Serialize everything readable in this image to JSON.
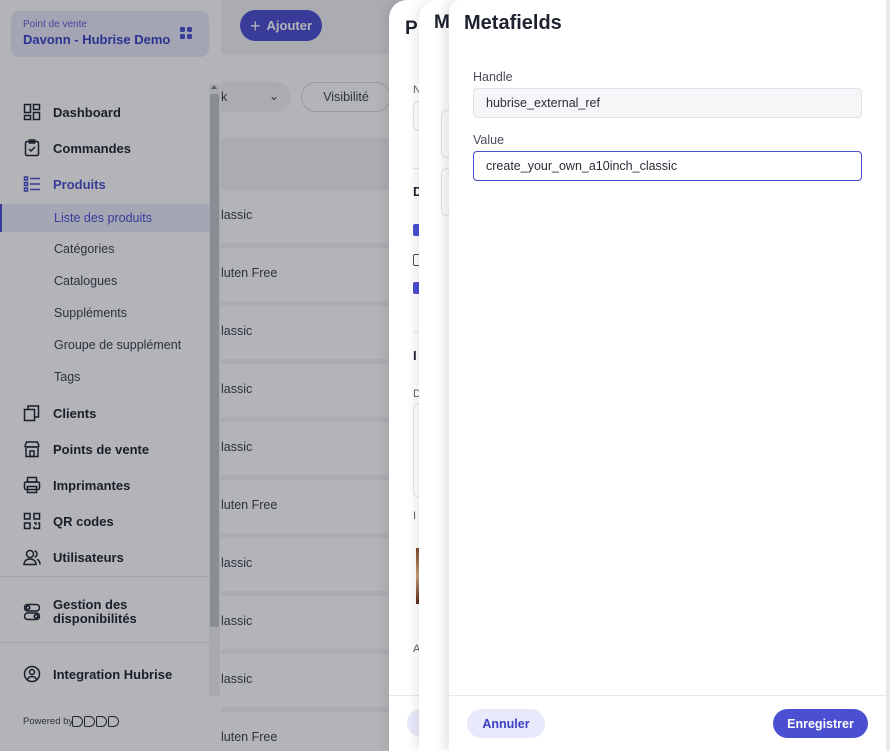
{
  "store": {
    "caption": "Point de vente",
    "name": "Davonn - Hubrise Demo"
  },
  "sidebar": {
    "items": [
      {
        "label": "Dashboard",
        "icon": "dashboard-icon"
      },
      {
        "label": "Commandes",
        "icon": "clipboard-icon"
      },
      {
        "label": "Produits",
        "icon": "list-icon",
        "active": true
      },
      {
        "label": "Clients",
        "icon": "copy-icon"
      },
      {
        "label": "Points de vente",
        "icon": "store-icon"
      },
      {
        "label": "Imprimantes",
        "icon": "printer-icon"
      },
      {
        "label": "QR codes",
        "icon": "qr-code-icon"
      },
      {
        "label": "Utilisateurs",
        "icon": "users-icon"
      },
      {
        "label": "Gestion des disponibilités",
        "icon": "toggle-icon"
      },
      {
        "label": "Integration Hubrise",
        "icon": "integration-icon"
      }
    ],
    "sub_items": [
      {
        "label": "Liste des produits",
        "active": true
      },
      {
        "label": "Catégories"
      },
      {
        "label": "Catalogues"
      },
      {
        "label": "Suppléments"
      },
      {
        "label": "Groupe de supplément"
      },
      {
        "label": "Tags"
      }
    ],
    "powered_by": "Powered by"
  },
  "main": {
    "add_label": "Ajouter",
    "filter_partial": "k",
    "visibility_label": "Visibilité",
    "rows": [
      "lassic",
      "luten Free",
      "lassic",
      "lassic",
      "lassic",
      "luten Free",
      "lassic",
      "lassic",
      "lassic",
      "luten Free"
    ]
  },
  "panel1": {
    "title_partial": "P"
  },
  "panel2": {
    "title_partial": "M"
  },
  "metafields": {
    "title": "Metafields",
    "handle_label": "Handle",
    "handle_value": "hubrise_external_ref",
    "value_label": "Value",
    "value_value": "create_your_own_a10inch_classic",
    "cancel_label": "Annuler",
    "save_label": "Enregistrer"
  },
  "colors": {
    "accent": "#4b4fd1",
    "accent_soft": "#e8e9fb"
  }
}
